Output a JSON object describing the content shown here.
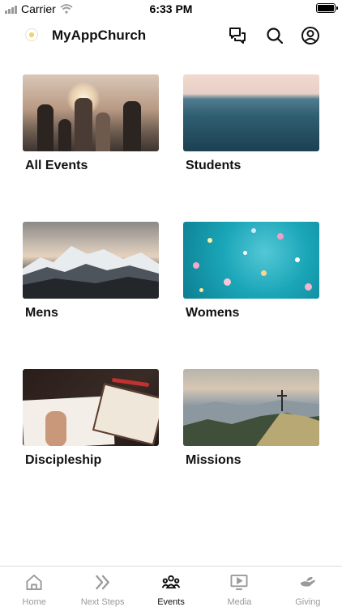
{
  "status_bar": {
    "carrier": "Carrier",
    "time": "6:33 PM"
  },
  "header": {
    "title": "MyAppChurch"
  },
  "categories": [
    {
      "label": "All Events"
    },
    {
      "label": "Students"
    },
    {
      "label": "Mens"
    },
    {
      "label": "Womens"
    },
    {
      "label": "Discipleship"
    },
    {
      "label": "Missions"
    }
  ],
  "tab_bar": {
    "tabs": [
      {
        "label": "Home",
        "icon": "home-icon"
      },
      {
        "label": "Next Steps",
        "icon": "chevrons-right-icon"
      },
      {
        "label": "Events",
        "icon": "group-icon",
        "active": true
      },
      {
        "label": "Media",
        "icon": "play-screen-icon"
      },
      {
        "label": "Giving",
        "icon": "giving-hand-icon"
      }
    ]
  },
  "colors": {
    "active_tab": "#111111",
    "inactive_tab": "#9a9a9a"
  }
}
